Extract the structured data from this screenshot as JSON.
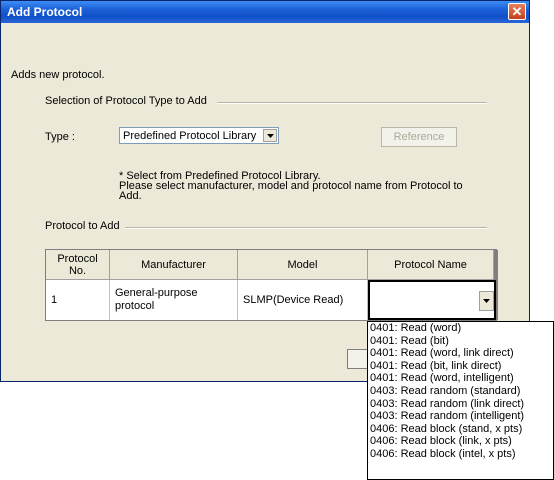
{
  "window": {
    "title": "Add Protocol",
    "close_glyph": "✕"
  },
  "description": "Adds new protocol.",
  "type_group": {
    "label": "Selection of Protocol Type to Add",
    "type_label": "Type :",
    "type_value": "Predefined Protocol Library",
    "reference_label": "Reference",
    "note_lines": [
      "* Select from Predefined Protocol Library.",
      "Please select manufacturer, model and protocol name from Protocol to",
      "Add."
    ]
  },
  "protocol_group": {
    "label": "Protocol to Add",
    "columns": [
      "Protocol No.",
      "Manufacturer",
      "Model",
      "Protocol Name"
    ],
    "rows": [
      {
        "no": "1",
        "manufacturer": "General-purpose protocol",
        "model": "SLMP(Device Read)",
        "protocol_name": ""
      }
    ]
  },
  "dropdown_options": [
    "0401: Read (word)",
    "0401: Read (bit)",
    "0401: Read (word, link direct)",
    "0401: Read (bit, link direct)",
    "0401: Read (word, intelligent)",
    "0403: Read random (standard)",
    "0403: Read random (link direct)",
    "0403: Read random (intelligent)",
    "0406: Read block (stand, x pts)",
    "0406: Read block (link, x pts)",
    "0406: Read block (intel, x pts)"
  ]
}
